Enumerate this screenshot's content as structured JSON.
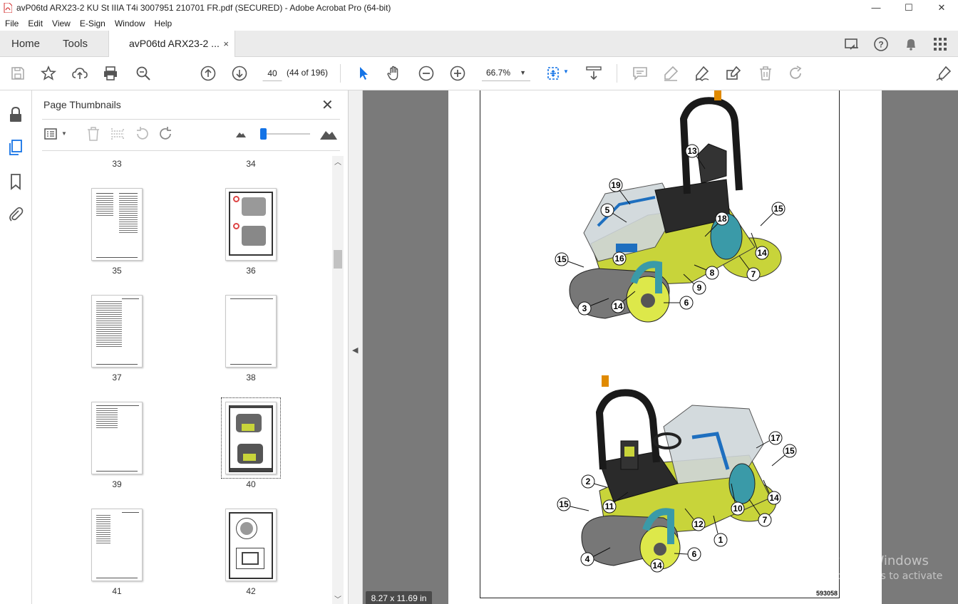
{
  "window": {
    "title": "avP06td ARX23-2 KU St IIIA T4i 3007951 210701 FR.pdf (SECURED) - Adobe Acrobat Pro (64-bit)"
  },
  "menu": [
    "File",
    "Edit",
    "View",
    "E-Sign",
    "Window",
    "Help"
  ],
  "tabs": {
    "home": "Home",
    "tools": "Tools",
    "document": "avP06td ARX23-2 ...",
    "close": "×"
  },
  "toolbar": {
    "page_current": "40",
    "page_of": "(44 of 196)",
    "zoom": "66.7%"
  },
  "panel": {
    "title": "Page Thumbnails",
    "thumbs": [
      {
        "label": "33"
      },
      {
        "label": "34"
      },
      {
        "label": "35"
      },
      {
        "label": "36"
      },
      {
        "label": "37"
      },
      {
        "label": "38"
      },
      {
        "label": "39"
      },
      {
        "label": "40"
      },
      {
        "label": "41"
      },
      {
        "label": "42"
      }
    ],
    "selected": "40"
  },
  "document": {
    "page_size": "8.27 x 11.69 in",
    "doc_id": "593058",
    "callouts_top": [
      "13",
      "19",
      "5",
      "18",
      "15",
      "16",
      "14",
      "15",
      "8",
      "7",
      "9",
      "3",
      "14",
      "6"
    ],
    "callouts_bottom": [
      "17",
      "15",
      "2",
      "11",
      "14",
      "15",
      "10",
      "7",
      "12",
      "1",
      "4",
      "6",
      "14"
    ]
  },
  "watermark": {
    "line1": "Activate Windows",
    "line2": "Go to Settings to activate Windows."
  },
  "colors": {
    "accent": "#1473e6",
    "machine_yellow": "#c8d43a",
    "doc_bg": "#7a7a7a"
  }
}
